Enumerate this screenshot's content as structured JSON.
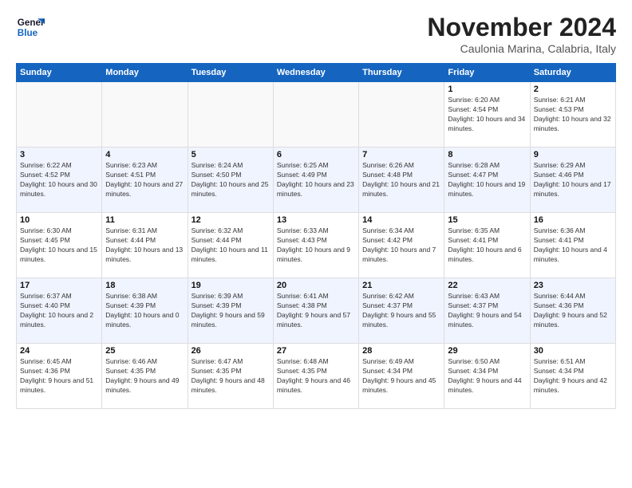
{
  "header": {
    "logo_line1": "General",
    "logo_line2": "Blue",
    "month": "November 2024",
    "location": "Caulonia Marina, Calabria, Italy"
  },
  "days_of_week": [
    "Sunday",
    "Monday",
    "Tuesday",
    "Wednesday",
    "Thursday",
    "Friday",
    "Saturday"
  ],
  "weeks": [
    [
      {
        "day": "",
        "info": ""
      },
      {
        "day": "",
        "info": ""
      },
      {
        "day": "",
        "info": ""
      },
      {
        "day": "",
        "info": ""
      },
      {
        "day": "",
        "info": ""
      },
      {
        "day": "1",
        "info": "Sunrise: 6:20 AM\nSunset: 4:54 PM\nDaylight: 10 hours and 34 minutes."
      },
      {
        "day": "2",
        "info": "Sunrise: 6:21 AM\nSunset: 4:53 PM\nDaylight: 10 hours and 32 minutes."
      }
    ],
    [
      {
        "day": "3",
        "info": "Sunrise: 6:22 AM\nSunset: 4:52 PM\nDaylight: 10 hours and 30 minutes."
      },
      {
        "day": "4",
        "info": "Sunrise: 6:23 AM\nSunset: 4:51 PM\nDaylight: 10 hours and 27 minutes."
      },
      {
        "day": "5",
        "info": "Sunrise: 6:24 AM\nSunset: 4:50 PM\nDaylight: 10 hours and 25 minutes."
      },
      {
        "day": "6",
        "info": "Sunrise: 6:25 AM\nSunset: 4:49 PM\nDaylight: 10 hours and 23 minutes."
      },
      {
        "day": "7",
        "info": "Sunrise: 6:26 AM\nSunset: 4:48 PM\nDaylight: 10 hours and 21 minutes."
      },
      {
        "day": "8",
        "info": "Sunrise: 6:28 AM\nSunset: 4:47 PM\nDaylight: 10 hours and 19 minutes."
      },
      {
        "day": "9",
        "info": "Sunrise: 6:29 AM\nSunset: 4:46 PM\nDaylight: 10 hours and 17 minutes."
      }
    ],
    [
      {
        "day": "10",
        "info": "Sunrise: 6:30 AM\nSunset: 4:45 PM\nDaylight: 10 hours and 15 minutes."
      },
      {
        "day": "11",
        "info": "Sunrise: 6:31 AM\nSunset: 4:44 PM\nDaylight: 10 hours and 13 minutes."
      },
      {
        "day": "12",
        "info": "Sunrise: 6:32 AM\nSunset: 4:44 PM\nDaylight: 10 hours and 11 minutes."
      },
      {
        "day": "13",
        "info": "Sunrise: 6:33 AM\nSunset: 4:43 PM\nDaylight: 10 hours and 9 minutes."
      },
      {
        "day": "14",
        "info": "Sunrise: 6:34 AM\nSunset: 4:42 PM\nDaylight: 10 hours and 7 minutes."
      },
      {
        "day": "15",
        "info": "Sunrise: 6:35 AM\nSunset: 4:41 PM\nDaylight: 10 hours and 6 minutes."
      },
      {
        "day": "16",
        "info": "Sunrise: 6:36 AM\nSunset: 4:41 PM\nDaylight: 10 hours and 4 minutes."
      }
    ],
    [
      {
        "day": "17",
        "info": "Sunrise: 6:37 AM\nSunset: 4:40 PM\nDaylight: 10 hours and 2 minutes."
      },
      {
        "day": "18",
        "info": "Sunrise: 6:38 AM\nSunset: 4:39 PM\nDaylight: 10 hours and 0 minutes."
      },
      {
        "day": "19",
        "info": "Sunrise: 6:39 AM\nSunset: 4:39 PM\nDaylight: 9 hours and 59 minutes."
      },
      {
        "day": "20",
        "info": "Sunrise: 6:41 AM\nSunset: 4:38 PM\nDaylight: 9 hours and 57 minutes."
      },
      {
        "day": "21",
        "info": "Sunrise: 6:42 AM\nSunset: 4:37 PM\nDaylight: 9 hours and 55 minutes."
      },
      {
        "day": "22",
        "info": "Sunrise: 6:43 AM\nSunset: 4:37 PM\nDaylight: 9 hours and 54 minutes."
      },
      {
        "day": "23",
        "info": "Sunrise: 6:44 AM\nSunset: 4:36 PM\nDaylight: 9 hours and 52 minutes."
      }
    ],
    [
      {
        "day": "24",
        "info": "Sunrise: 6:45 AM\nSunset: 4:36 PM\nDaylight: 9 hours and 51 minutes."
      },
      {
        "day": "25",
        "info": "Sunrise: 6:46 AM\nSunset: 4:35 PM\nDaylight: 9 hours and 49 minutes."
      },
      {
        "day": "26",
        "info": "Sunrise: 6:47 AM\nSunset: 4:35 PM\nDaylight: 9 hours and 48 minutes."
      },
      {
        "day": "27",
        "info": "Sunrise: 6:48 AM\nSunset: 4:35 PM\nDaylight: 9 hours and 46 minutes."
      },
      {
        "day": "28",
        "info": "Sunrise: 6:49 AM\nSunset: 4:34 PM\nDaylight: 9 hours and 45 minutes."
      },
      {
        "day": "29",
        "info": "Sunrise: 6:50 AM\nSunset: 4:34 PM\nDaylight: 9 hours and 44 minutes."
      },
      {
        "day": "30",
        "info": "Sunrise: 6:51 AM\nSunset: 4:34 PM\nDaylight: 9 hours and 42 minutes."
      }
    ]
  ]
}
